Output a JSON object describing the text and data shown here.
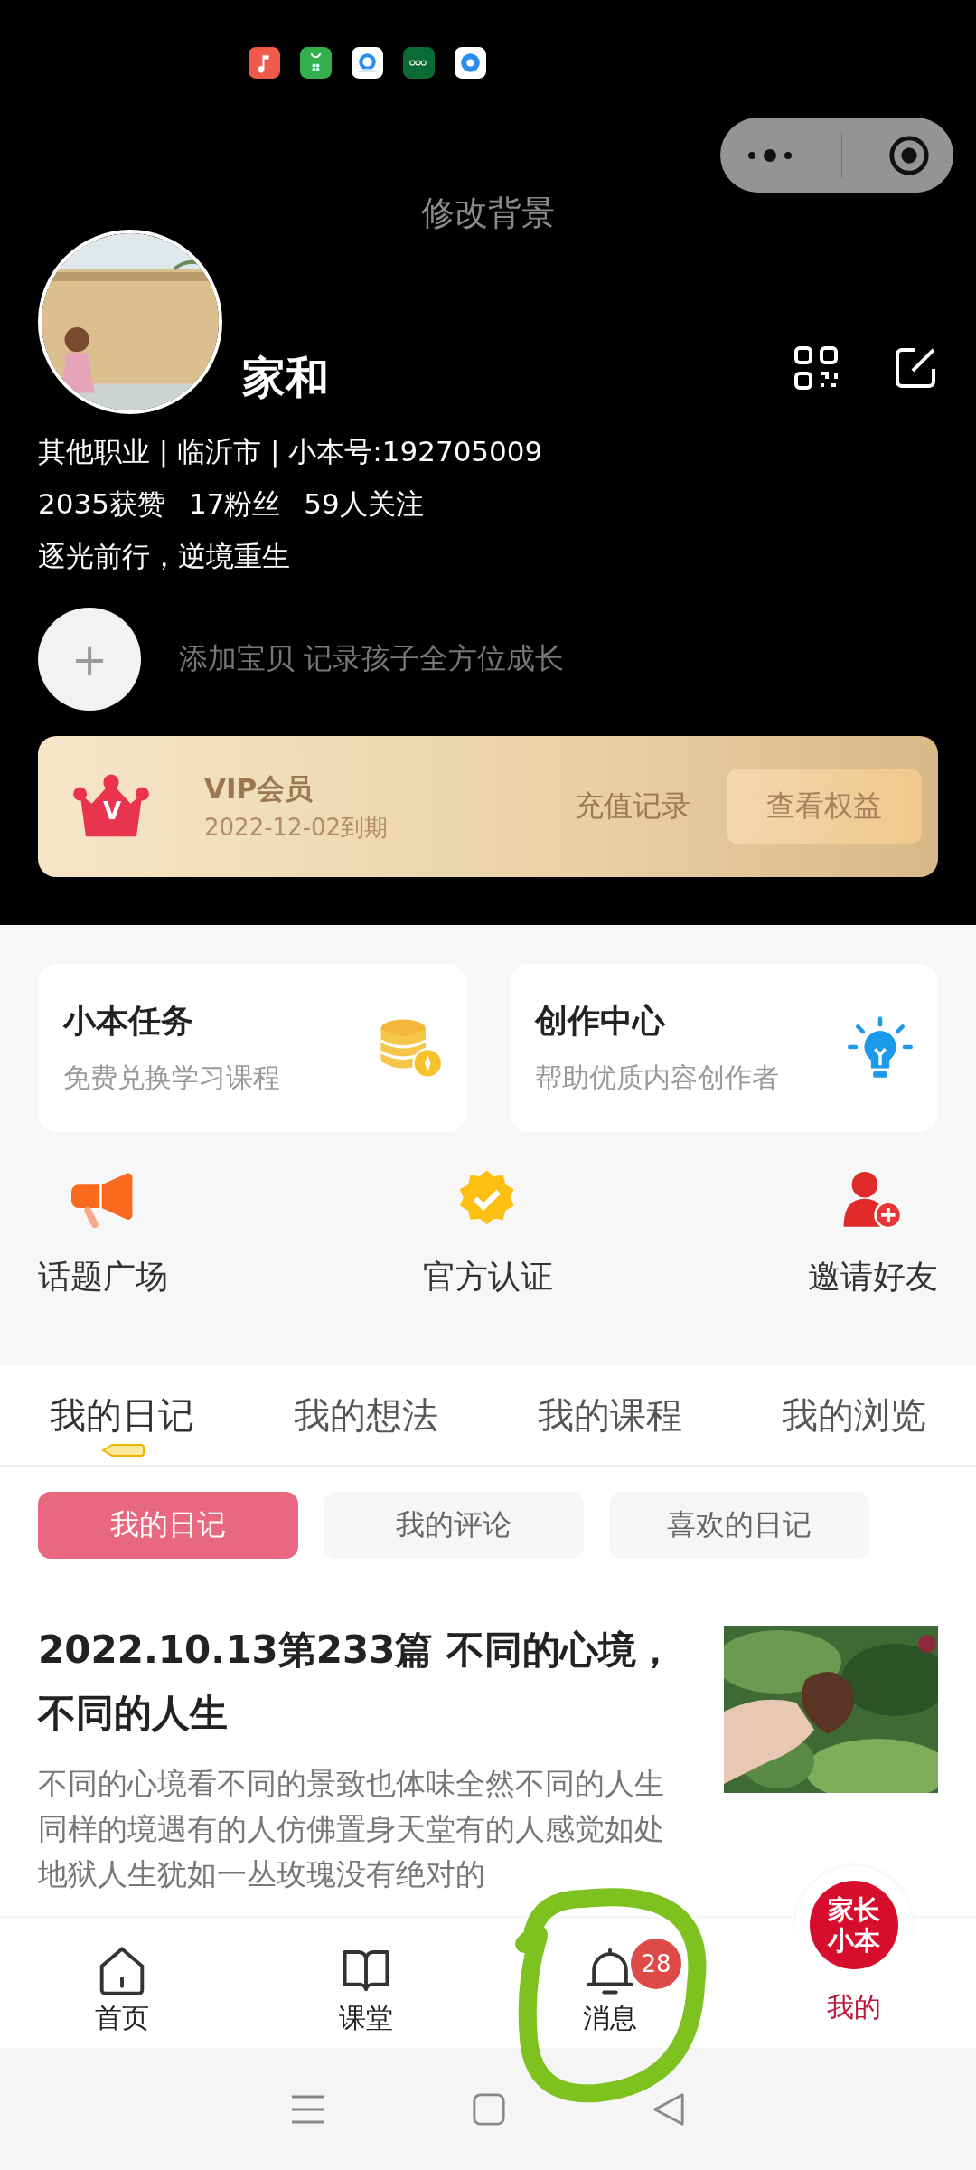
{
  "header": {
    "title": "修改背景"
  },
  "profile": {
    "name": "家和",
    "info": "其他职业 | 临沂市 | 小本号:192705009",
    "stats": [
      "2035获赞",
      "17粉丝",
      "59人关注"
    ],
    "motto": "逐光前行，逆境重生",
    "add_child_icon": "+",
    "add_child": "添加宝贝 记录孩子全方位成长"
  },
  "vip": {
    "title": "VIP会员",
    "expiry": "2022-12-02到期",
    "badge": "V",
    "link": "充值记录",
    "button": "查看权益"
  },
  "cards": [
    {
      "title": "小本任务",
      "subtitle": "免费兑换学习课程",
      "kind": "coins"
    },
    {
      "title": "创作中心",
      "subtitle": "帮助优质内容创作者",
      "kind": "bulb"
    }
  ],
  "shortcuts": [
    {
      "label": "话题广场",
      "kind": "megaphone"
    },
    {
      "label": "官方认证",
      "kind": "badge"
    },
    {
      "label": "邀请好友",
      "kind": "invite"
    }
  ],
  "tabs": [
    {
      "label": "我的日记",
      "selected": true
    },
    {
      "label": "我的想法",
      "selected": false
    },
    {
      "label": "我的课程",
      "selected": false
    },
    {
      "label": "我的浏览",
      "selected": false
    }
  ],
  "subtabs": [
    {
      "label": "我的日记",
      "selected": true
    },
    {
      "label": "我的评论",
      "selected": false
    },
    {
      "label": "喜欢的日记",
      "selected": false
    }
  ],
  "article": {
    "title": "2022.10.13第233篇 不同的心境，不同的人生",
    "excerpt": "不同的心境看不同的景致也体味全然不同的人生同样的境遇有的人仿佛置身天堂有的人感觉如处地狱人生犹如一丛玫瑰没有绝对的"
  },
  "bottom_nav": [
    {
      "label": "首页",
      "kind": "home",
      "selected": false
    },
    {
      "label": "课堂",
      "kind": "book",
      "selected": false
    },
    {
      "label": "消息",
      "kind": "bell",
      "selected": false,
      "badge": "28"
    },
    {
      "label": "我的",
      "kind": "logo",
      "selected": true,
      "logo_text": "家长小本"
    }
  ]
}
